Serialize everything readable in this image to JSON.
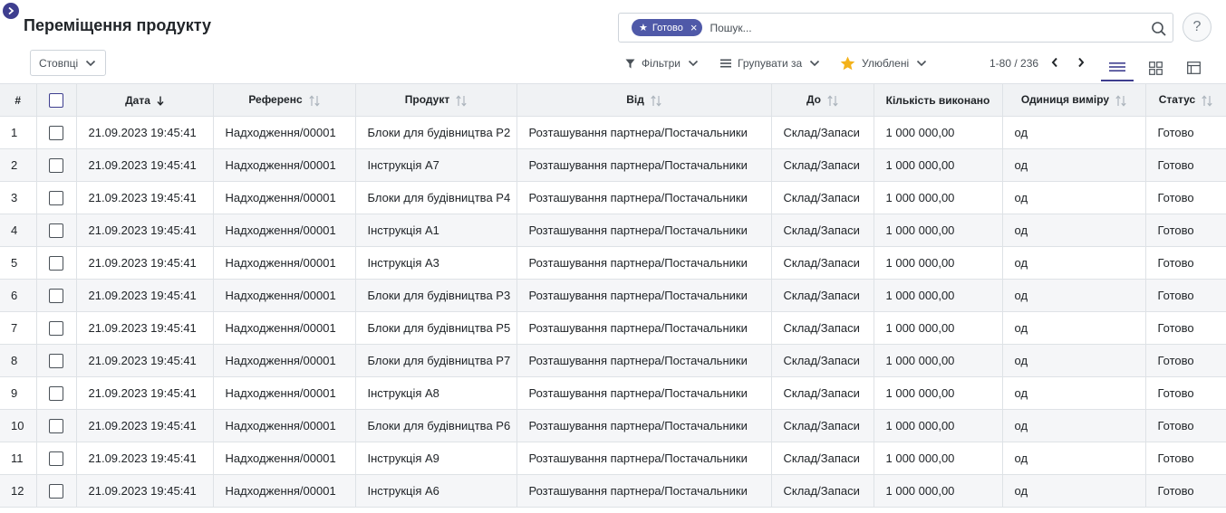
{
  "header": {
    "title": "Переміщення продукту",
    "columns_button": "Стовпці",
    "help_label": "?"
  },
  "search": {
    "facet_label": "Готово",
    "placeholder": "Пошук..."
  },
  "toolbar": {
    "filters": "Фільтри",
    "group_by": "Групувати за",
    "favorites": "Улюблені"
  },
  "pager": {
    "range": "1-80 / 236"
  },
  "colors": {
    "accent": "#3e3e8f",
    "facet": "#4f59a8",
    "star": "#f3b21b"
  },
  "table": {
    "headers": {
      "num": "#",
      "date": "Дата",
      "reference": "Референс",
      "product": "Продукт",
      "from": "Від",
      "to": "До",
      "qty": "Кількість виконано",
      "uom": "Одиниця виміру",
      "status": "Статус"
    },
    "rows": [
      {
        "num": "1",
        "date": "21.09.2023 19:45:41",
        "reference": "Надходження/00001",
        "product": "Блоки для будівництва P2",
        "from": "Розташування партнера/Постачальники",
        "to": "Склад/Запаси",
        "qty": "1 000 000,00",
        "uom": "од",
        "status": "Готово"
      },
      {
        "num": "2",
        "date": "21.09.2023 19:45:41",
        "reference": "Надходження/00001",
        "product": "Інструкція A7",
        "from": "Розташування партнера/Постачальники",
        "to": "Склад/Запаси",
        "qty": "1 000 000,00",
        "uom": "од",
        "status": "Готово"
      },
      {
        "num": "3",
        "date": "21.09.2023 19:45:41",
        "reference": "Надходження/00001",
        "product": "Блоки для будівництва P4",
        "from": "Розташування партнера/Постачальники",
        "to": "Склад/Запаси",
        "qty": "1 000 000,00",
        "uom": "од",
        "status": "Готово"
      },
      {
        "num": "4",
        "date": "21.09.2023 19:45:41",
        "reference": "Надходження/00001",
        "product": "Інструкція A1",
        "from": "Розташування партнера/Постачальники",
        "to": "Склад/Запаси",
        "qty": "1 000 000,00",
        "uom": "од",
        "status": "Готово"
      },
      {
        "num": "5",
        "date": "21.09.2023 19:45:41",
        "reference": "Надходження/00001",
        "product": "Інструкція A3",
        "from": "Розташування партнера/Постачальники",
        "to": "Склад/Запаси",
        "qty": "1 000 000,00",
        "uom": "од",
        "status": "Готово"
      },
      {
        "num": "6",
        "date": "21.09.2023 19:45:41",
        "reference": "Надходження/00001",
        "product": "Блоки для будівництва P3",
        "from": "Розташування партнера/Постачальники",
        "to": "Склад/Запаси",
        "qty": "1 000 000,00",
        "uom": "од",
        "status": "Готово"
      },
      {
        "num": "7",
        "date": "21.09.2023 19:45:41",
        "reference": "Надходження/00001",
        "product": "Блоки для будівництва P5",
        "from": "Розташування партнера/Постачальники",
        "to": "Склад/Запаси",
        "qty": "1 000 000,00",
        "uom": "од",
        "status": "Готово"
      },
      {
        "num": "8",
        "date": "21.09.2023 19:45:41",
        "reference": "Надходження/00001",
        "product": "Блоки для будівництва P7",
        "from": "Розташування партнера/Постачальники",
        "to": "Склад/Запаси",
        "qty": "1 000 000,00",
        "uom": "од",
        "status": "Готово"
      },
      {
        "num": "9",
        "date": "21.09.2023 19:45:41",
        "reference": "Надходження/00001",
        "product": "Інструкція A8",
        "from": "Розташування партнера/Постачальники",
        "to": "Склад/Запаси",
        "qty": "1 000 000,00",
        "uom": "од",
        "status": "Готово"
      },
      {
        "num": "10",
        "date": "21.09.2023 19:45:41",
        "reference": "Надходження/00001",
        "product": "Блоки для будівництва P6",
        "from": "Розташування партнера/Постачальники",
        "to": "Склад/Запаси",
        "qty": "1 000 000,00",
        "uom": "од",
        "status": "Готово"
      },
      {
        "num": "11",
        "date": "21.09.2023 19:45:41",
        "reference": "Надходження/00001",
        "product": "Інструкція A9",
        "from": "Розташування партнера/Постачальники",
        "to": "Склад/Запаси",
        "qty": "1 000 000,00",
        "uom": "од",
        "status": "Готово"
      },
      {
        "num": "12",
        "date": "21.09.2023 19:45:41",
        "reference": "Надходження/00001",
        "product": "Інструкція A6",
        "from": "Розташування партнера/Постачальники",
        "to": "Склад/Запаси",
        "qty": "1 000 000,00",
        "uom": "од",
        "status": "Готово"
      }
    ]
  }
}
